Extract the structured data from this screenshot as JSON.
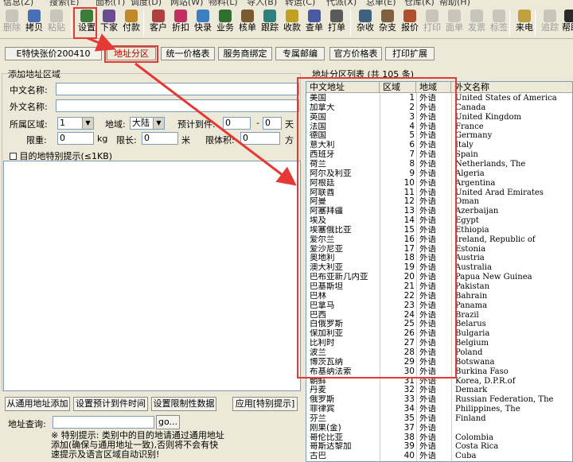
{
  "menu": [
    "信息(Z)",
    "搜索(E)",
    "面积(T)",
    "调度(D)",
    "网站(W)",
    "物料(L)",
    "导入(B)",
    "转运(C)",
    "代派(X)",
    "总单(E)",
    "仓库(K)",
    "帮助(H)"
  ],
  "toolbar": [
    {
      "label": "删除",
      "icon": "delete-icon",
      "disabled": true
    },
    {
      "label": "拷贝",
      "icon": "copy-icon",
      "disabled": false
    },
    {
      "label": "粘贴",
      "icon": "paste-icon",
      "disabled": true
    },
    {
      "label": "设置",
      "icon": "settings-icon",
      "disabled": false
    },
    {
      "label": "下家",
      "icon": "downstream-icon",
      "disabled": false
    },
    {
      "label": "付款",
      "icon": "payment-icon",
      "disabled": false
    },
    {
      "label": "客户",
      "icon": "customers-icon",
      "disabled": false
    },
    {
      "label": "折扣",
      "icon": "discount-icon",
      "disabled": false
    },
    {
      "label": "快录",
      "icon": "quick-entry-icon",
      "disabled": false
    },
    {
      "label": "业务",
      "icon": "business-icon",
      "disabled": false
    },
    {
      "label": "核单",
      "icon": "verify-icon",
      "disabled": false
    },
    {
      "label": "跟踪",
      "icon": "tracking-icon",
      "disabled": false
    },
    {
      "label": "收款",
      "icon": "receipt-icon",
      "disabled": false
    },
    {
      "label": "查单",
      "icon": "lookup-icon",
      "disabled": false
    },
    {
      "label": "打单",
      "icon": "print-order-icon",
      "disabled": false
    },
    {
      "label": "杂收",
      "icon": "misc-receive-icon",
      "disabled": false
    },
    {
      "label": "杂支",
      "icon": "misc-pay-icon",
      "disabled": false
    },
    {
      "label": "报价",
      "icon": "quote-icon",
      "disabled": false
    },
    {
      "label": "打印",
      "icon": "print-icon",
      "disabled": true
    },
    {
      "label": "面单",
      "icon": "waybill-icon",
      "disabled": true
    },
    {
      "label": "发票",
      "icon": "invoice-icon",
      "disabled": true
    },
    {
      "label": "标签",
      "icon": "label-icon",
      "disabled": true
    },
    {
      "label": "来电",
      "icon": "phone-icon",
      "disabled": false
    },
    {
      "label": "追踪",
      "icon": "track-icon",
      "disabled": true
    },
    {
      "label": "帮助",
      "icon": "help-icon",
      "disabled": false
    }
  ],
  "tabs": [
    "E特快张价200410",
    "地址分区",
    "统一价格表",
    "服务商绑定",
    "专属邮编",
    "官方价格表",
    "打印扩展"
  ],
  "form": {
    "section_title": "添加地址区域",
    "cn_name_label": "中文名称:",
    "en_name_label": "外文名称:",
    "region_label": "所属区域:",
    "region_value": "1",
    "domain_label": "地域:",
    "domain_value": "大陆",
    "days_label": "预计到件:",
    "days_from": "0",
    "days_dash": "-",
    "days_to": "0",
    "days_unit": "天",
    "weight_label": "限重:",
    "weight_value": "0",
    "weight_unit": "kg",
    "length_label": "限长:",
    "length_value": "0",
    "length_unit": "米",
    "volume_label": "限体积:",
    "volume_value": "0",
    "volume_unit": "方",
    "hint_checkbox_label": "目的地特别提示(≤1KB)",
    "btn_add_common": "从通用地址添加",
    "btn_set_days": "设置预计到件时间",
    "btn_set_limits": "设置限制性数据",
    "btn_apply_hint": "应用[特别提示]",
    "query_label": "地址查询:",
    "go_label": "go...",
    "note": "※ 特别提示: 类别中的目的地请通过通用地址添加(确保与通用地址一致),否则将不会有快速提示及语言区域自动识别!"
  },
  "list": {
    "title": "地址分区列表 (共 105 条)",
    "headers": [
      "中文地址",
      "区域",
      "地域",
      "外文名称"
    ],
    "rows": [
      [
        "美国",
        "1",
        "外语",
        "United States of America"
      ],
      [
        "加拿大",
        "2",
        "外语",
        "Canada"
      ],
      [
        "英国",
        "3",
        "外语",
        "United Kingdom"
      ],
      [
        "法国",
        "4",
        "外语",
        "France"
      ],
      [
        "德国",
        "5",
        "外语",
        "Germany"
      ],
      [
        "意大利",
        "6",
        "外语",
        "Italy"
      ],
      [
        "西班牙",
        "7",
        "外语",
        "Spain"
      ],
      [
        "荷兰",
        "8",
        "外语",
        "Netherlands, The"
      ],
      [
        "阿尔及利亚",
        "9",
        "外语",
        "Algeria"
      ],
      [
        "阿根廷",
        "10",
        "外语",
        "Argentina"
      ],
      [
        "阿联酋",
        "11",
        "外语",
        "United Arad Emirates"
      ],
      [
        "阿曼",
        "12",
        "外语",
        "Oman"
      ],
      [
        "阿塞拜疆",
        "13",
        "外语",
        "Azerbaijan"
      ],
      [
        "埃及",
        "14",
        "外语",
        "Egypt"
      ],
      [
        "埃塞俄比亚",
        "15",
        "外语",
        "Ethiopia"
      ],
      [
        "爱尔兰",
        "16",
        "外语",
        "Ireland, Republic of"
      ],
      [
        "爱沙尼亚",
        "17",
        "外语",
        "Estonia"
      ],
      [
        "奥地利",
        "18",
        "外语",
        "Austria"
      ],
      [
        "澳大利亚",
        "19",
        "外语",
        "Australia"
      ],
      [
        "巴布亚新几内亚",
        "20",
        "外语",
        "Papua New Guinea"
      ],
      [
        "巴基斯坦",
        "21",
        "外语",
        "Pakistan"
      ],
      [
        "巴林",
        "22",
        "外语",
        "Bahrain"
      ],
      [
        "巴拿马",
        "23",
        "外语",
        "Panama"
      ],
      [
        "巴西",
        "24",
        "外语",
        "Brazil"
      ],
      [
        "白俄罗斯",
        "25",
        "外语",
        "Belarus"
      ],
      [
        "保加利亚",
        "26",
        "外语",
        "Bulgaria"
      ],
      [
        "比利时",
        "27",
        "外语",
        "Belgium"
      ],
      [
        "波兰",
        "28",
        "外语",
        "Poland"
      ],
      [
        "博茨瓦纳",
        "29",
        "外语",
        "Botswana"
      ],
      [
        "布基纳法索",
        "30",
        "外语",
        "Burkina Faso"
      ],
      [
        "朝鲜",
        "31",
        "外语",
        "Korea, D.P.R.of"
      ],
      [
        "丹麦",
        "32",
        "外语",
        "Demark"
      ],
      [
        "俄罗斯",
        "33",
        "外语",
        "Russian Federation, The"
      ],
      [
        "菲律宾",
        "34",
        "外语",
        "Philippines, The"
      ],
      [
        "芬兰",
        "35",
        "外语",
        "Finland"
      ],
      [
        "刚果(金)",
        "37",
        "外语",
        ""
      ],
      [
        "哥伦比亚",
        "38",
        "外语",
        "Colombia"
      ],
      [
        "哥斯达黎加",
        "39",
        "外语",
        "Costa Rica"
      ],
      [
        "古巴",
        "40",
        "外语",
        "Cuba"
      ]
    ]
  },
  "colors": {
    "highlight": "#e53935",
    "active_tab_text": "#c00000"
  }
}
